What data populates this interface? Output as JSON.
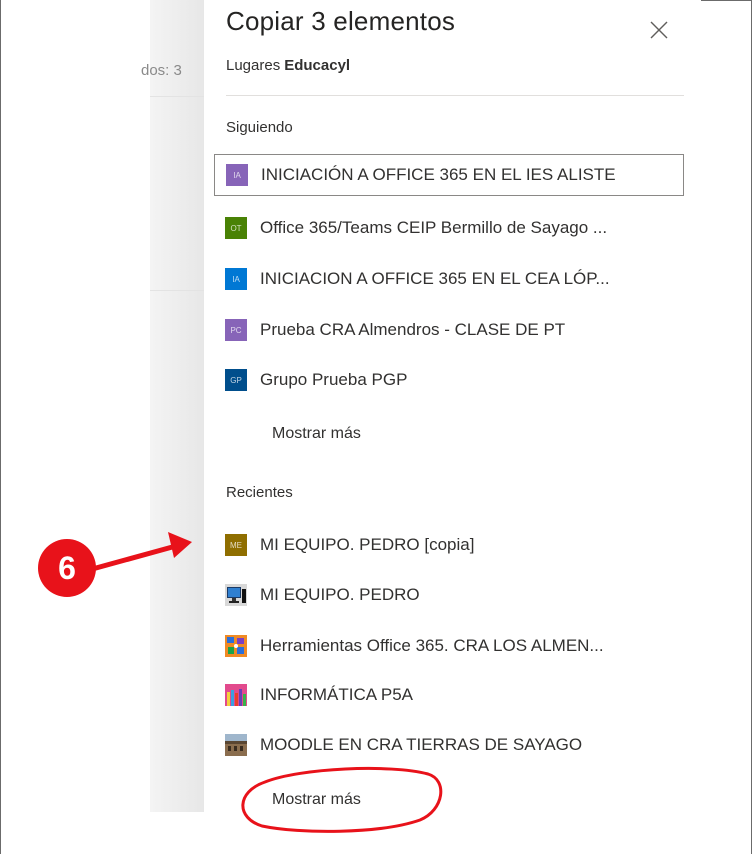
{
  "background": {
    "partial_text": "dos: 3"
  },
  "dialog": {
    "title": "Copiar 3 elementos",
    "breadcrumb": {
      "root": "Lugares",
      "current": "Educacyl"
    }
  },
  "following": {
    "heading": "Siguiendo",
    "items": [
      {
        "label": "INICIACIÓN A OFFICE 365 EN EL IES ALISTE",
        "initials": "IA",
        "color": "#8764b8"
      },
      {
        "label": "Office 365/Teams CEIP Bermillo de Sayago ...",
        "initials": "OT",
        "color": "#498205"
      },
      {
        "label": "INICIACION A OFFICE 365 EN EL CEA LÓP...",
        "initials": "IA",
        "color": "#0078d4"
      },
      {
        "label": "Prueba CRA Almendros - CLASE DE PT",
        "initials": "PC",
        "color": "#8764b8"
      },
      {
        "label": "Grupo Prueba PGP",
        "initials": "GP",
        "color": "#004e8c"
      }
    ],
    "show_more": "Mostrar más"
  },
  "recent": {
    "heading": "Recientes",
    "items": [
      {
        "label": "MI EQUIPO. PEDRO [copia]",
        "initials": "ME",
        "color": "#8f6e00"
      },
      {
        "label": "MI EQUIPO. PEDRO",
        "icon": "computer-icon"
      },
      {
        "label": "Herramientas Office 365. CRA LOS ALMEN...",
        "icon": "apps-collage-icon"
      },
      {
        "label": "INFORMÁTICA P5A",
        "icon": "colored-pencils-icon"
      },
      {
        "label": "MOODLE EN CRA TIERRAS DE SAYAGO",
        "icon": "school-building-icon"
      }
    ],
    "show_more": "Mostrar más"
  },
  "annotation": {
    "step": "6",
    "color": "#e8121a"
  }
}
